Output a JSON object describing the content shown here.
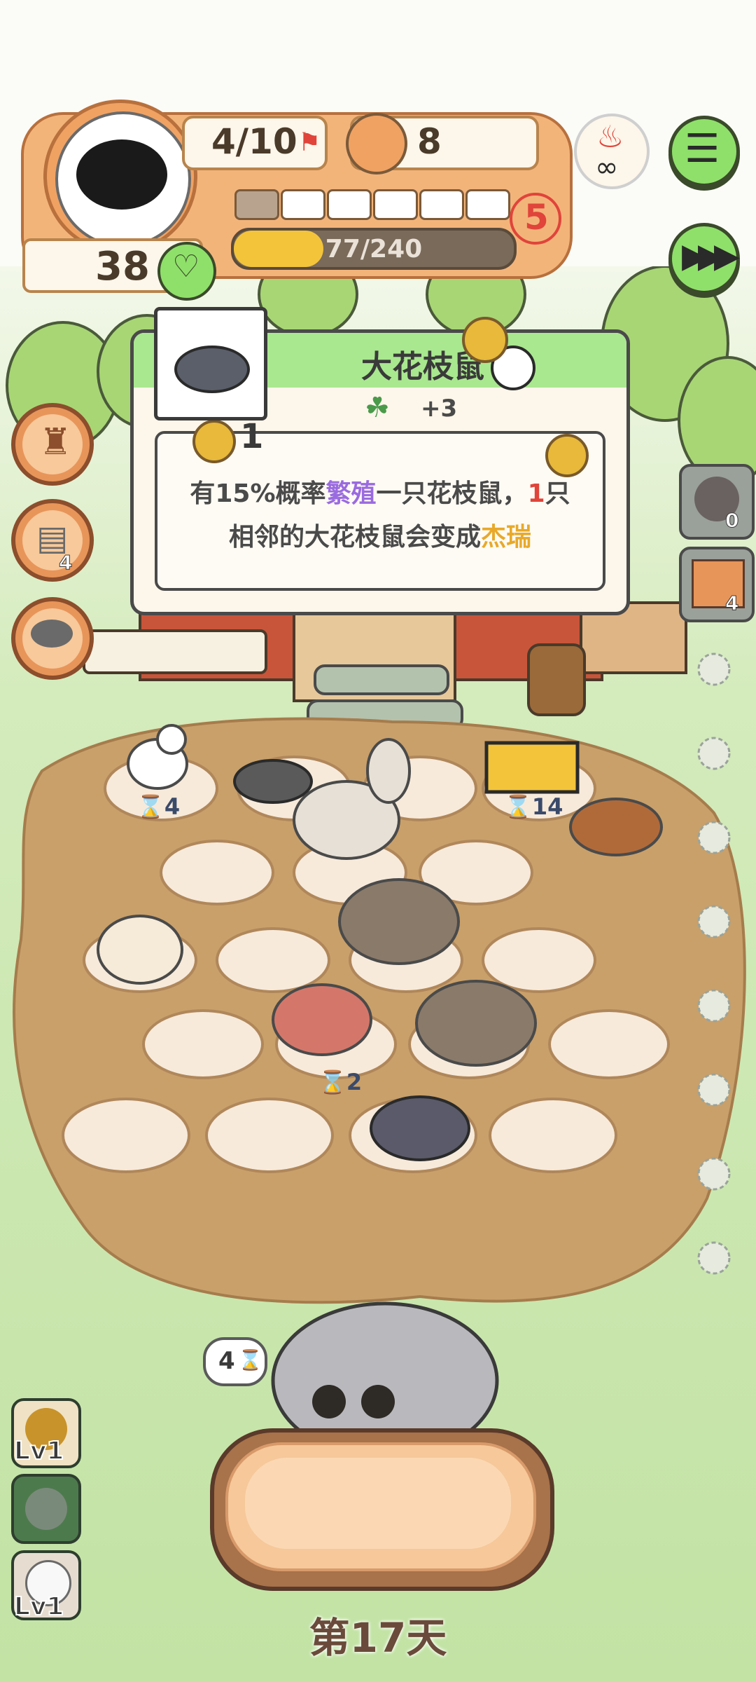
{
  "hud": {
    "pet_count": "4/10",
    "food_count": "8",
    "coins": "38",
    "level_number": "5",
    "progress_text": "77/240",
    "progress_fraction": 0.32,
    "segments_total": 6,
    "segments_filled": 1
  },
  "card": {
    "title": "大花枝鼠",
    "bonus": "+3",
    "tier": "1",
    "desc_line1_a": "有15%概率",
    "desc_line1_b": "繁殖",
    "desc_line1_c": "一只花枝鼠，",
    "desc_line1_d": "1",
    "desc_line1_e": "只",
    "desc_line2_a": "相邻的大花枝鼠会变成",
    "desc_line2_b": "杰瑞"
  },
  "side_left": [
    {
      "name": "cat-tree-icon",
      "badge": ""
    },
    {
      "name": "scratch-post-icon",
      "badge": "4"
    },
    {
      "name": "food-bowl-icon",
      "badge": ""
    }
  ],
  "side_right": [
    {
      "name": "rock-item-icon",
      "badge": "0"
    },
    {
      "name": "mystery-crate-icon",
      "badge": "4"
    }
  ],
  "board_timers": {
    "goat": "4",
    "barrier": "14",
    "red_dino": "2"
  },
  "cat_bubble": "4",
  "levels": [
    "Lv1",
    "Lv1"
  ],
  "day_label": "第17天",
  "colors": {
    "accent_green": "#8fe06a",
    "hud_orange": "#f0a263",
    "dirt": "#c9a06a",
    "grass": "#bfe3a0"
  }
}
